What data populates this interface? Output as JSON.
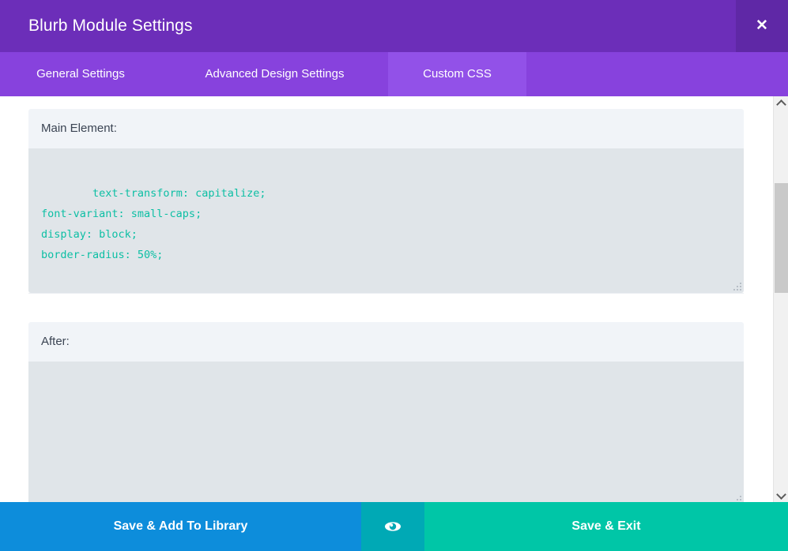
{
  "window": {
    "title": "Blurb Module Settings",
    "close_icon": "close-icon",
    "close_glyph": "✕"
  },
  "colors": {
    "titlebar_purple": "#6c2eb9",
    "close_purple": "#5f28a6",
    "tabbar_purple": "#8742dd",
    "tab_active_purple": "#9251e8",
    "label_bg": "#f1f4f8",
    "textarea_bg": "#e0e5e9",
    "code_teal": "#0cbfa4",
    "btn_blue": "#0d8ddb",
    "btn_preview_teal": "#00a9b5",
    "btn_green": "#00c6a7"
  },
  "tabs": [
    {
      "label": "General Settings",
      "active": false
    },
    {
      "label": "Advanced Design Settings",
      "active": false
    },
    {
      "label": "Custom CSS",
      "active": true
    }
  ],
  "fields": [
    {
      "label": "Main Element:",
      "value": "text-transform: capitalize;\nfont-variant: small-caps;\ndisplay: block;\nborder-radius: 50%;"
    },
    {
      "label": "After:",
      "value": ""
    }
  ],
  "scrollbar": {
    "up_arrow_icon": "chevron-up-icon",
    "down_arrow_icon": "chevron-down-icon"
  },
  "footer": {
    "save_add_library_label": "Save & Add To Library",
    "preview_icon": "eye-icon",
    "save_exit_label": "Save & Exit"
  }
}
